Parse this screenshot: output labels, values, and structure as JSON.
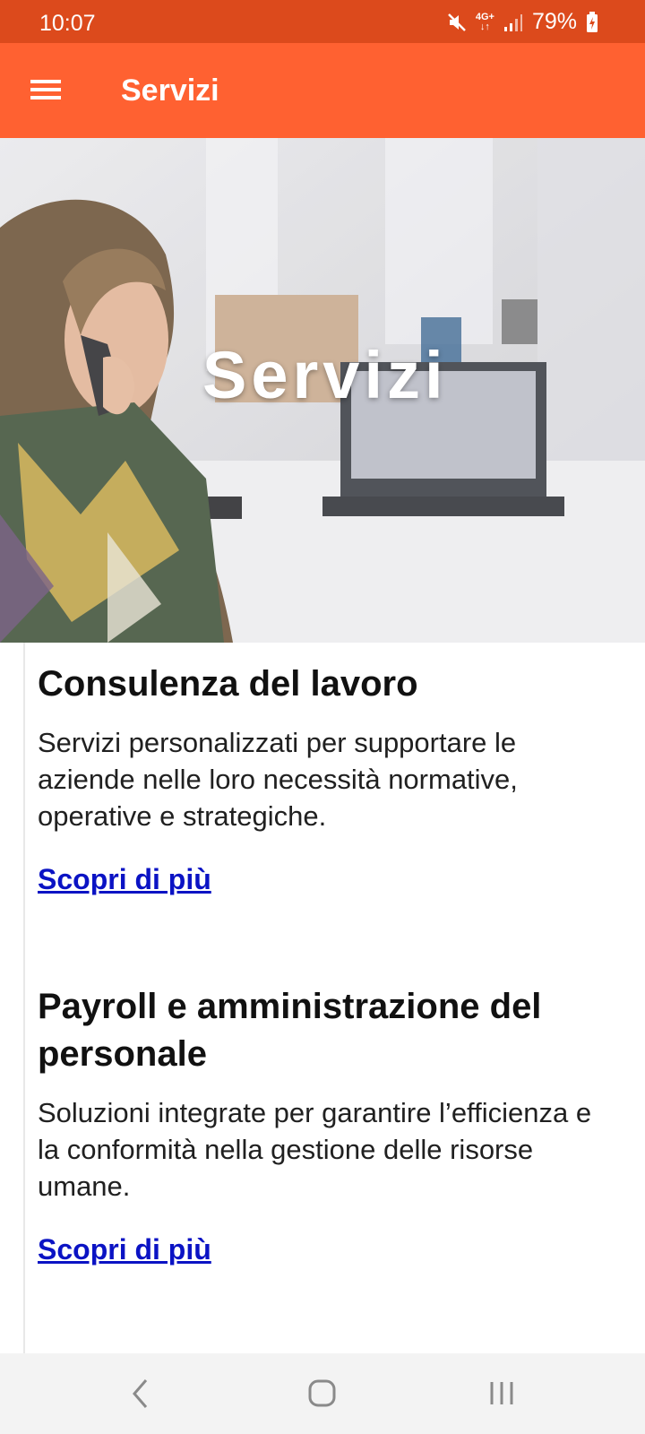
{
  "status_bar": {
    "time": "10:07",
    "network": "4G+",
    "battery": "79%",
    "icons": [
      "mute-icon",
      "network-4g-icon",
      "signal-icon",
      "battery-charging-icon"
    ]
  },
  "app_bar": {
    "menu_icon": "hamburger-menu-icon",
    "title": "Servizi"
  },
  "hero": {
    "overlay_text": "Servizi"
  },
  "services": [
    {
      "title": "Consulenza del lavoro",
      "description": "Servizi personalizzati per supportare le aziende nelle loro necessità normative, operative e strategiche.",
      "link": "Scopri di più"
    },
    {
      "title": "Payroll e amministrazione del personale",
      "description": "Soluzioni integrate per garantire l’efficienza e la conformità nella gestione delle risorse umane.",
      "link": "Scopri di più"
    }
  ],
  "navigation": {
    "buttons": [
      "back-icon",
      "home-icon",
      "recents-icon"
    ]
  },
  "colors": {
    "status_bar": "#dc4a1c",
    "app_bar": "#ff6131",
    "link": "#0b13c4"
  }
}
